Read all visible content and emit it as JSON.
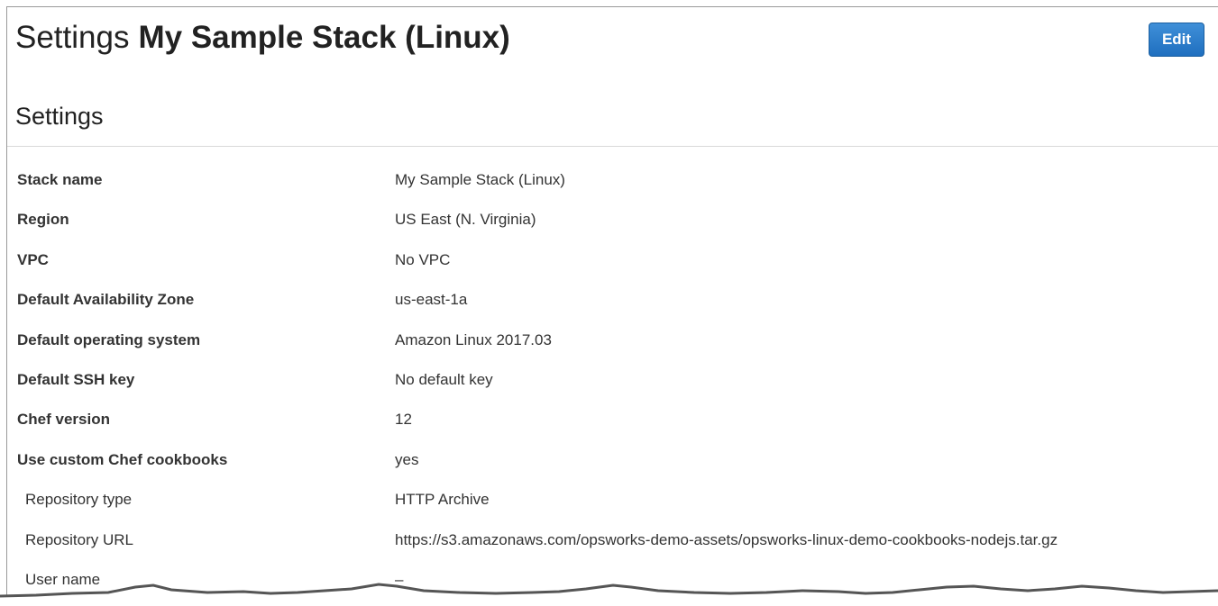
{
  "header": {
    "title_prefix": "Settings",
    "stack_name": "My Sample Stack (Linux)",
    "edit_label": "Edit"
  },
  "section": {
    "title": "Settings"
  },
  "settings": [
    {
      "label": "Stack name",
      "value": "My Sample Stack (Linux)"
    },
    {
      "label": "Region",
      "value": "US East (N. Virginia)"
    },
    {
      "label": "VPC",
      "value": "No VPC"
    },
    {
      "label": "Default Availability Zone",
      "value": "us-east-1a"
    },
    {
      "label": "Default operating system",
      "value": "Amazon Linux 2017.03"
    },
    {
      "label": "Default SSH key",
      "value": "No default key"
    },
    {
      "label": "Chef version",
      "value": "12"
    },
    {
      "label": "Use custom Chef cookbooks",
      "value": "yes"
    },
    {
      "label": "Repository type",
      "value": "HTTP Archive"
    },
    {
      "label": "Repository URL",
      "value": "https://s3.amazonaws.com/opsworks-demo-assets/opsworks-linux-demo-cookbooks-nodejs.tar.gz"
    },
    {
      "label": "User name",
      "value": "–"
    }
  ],
  "colors": {
    "edit_button": "#2a7ccc",
    "divider": "#d9d9d9"
  }
}
